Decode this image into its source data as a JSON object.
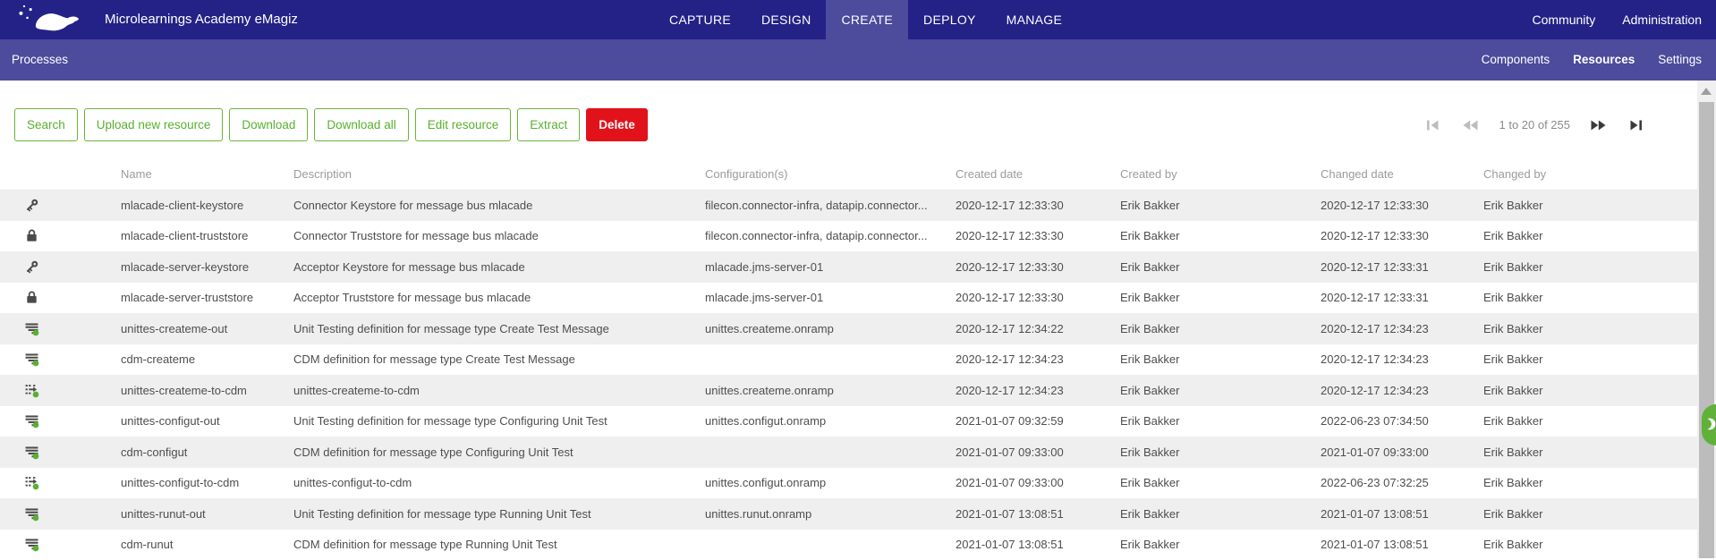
{
  "app": {
    "title": "Microlearnings Academy eMagiz",
    "logo": "emagiz-platypus-logo",
    "nav": [
      {
        "label": "CAPTURE",
        "active": false
      },
      {
        "label": "DESIGN",
        "active": false
      },
      {
        "label": "CREATE",
        "active": true
      },
      {
        "label": "DEPLOY",
        "active": false
      },
      {
        "label": "MANAGE",
        "active": false
      }
    ],
    "nav_right": [
      {
        "label": "Community"
      },
      {
        "label": "Administration"
      }
    ]
  },
  "subnav": {
    "left": "Processes",
    "right": [
      {
        "label": "Components",
        "active": false
      },
      {
        "label": "Resources",
        "active": true
      },
      {
        "label": "Settings",
        "active": false
      }
    ]
  },
  "toolbar": {
    "buttons": [
      {
        "label": "Search",
        "variant": "outline-green"
      },
      {
        "label": "Upload new resource",
        "variant": "outline-green"
      },
      {
        "label": "Download",
        "variant": "outline-green"
      },
      {
        "label": "Download all",
        "variant": "outline-green"
      },
      {
        "label": "Edit resource",
        "variant": "outline-green"
      },
      {
        "label": "Extract",
        "variant": "outline-green"
      },
      {
        "label": "Delete",
        "variant": "solid-red"
      }
    ]
  },
  "pagination": {
    "label": "1 to 20 of 255",
    "buttons": [
      {
        "name": "first-page",
        "enabled": false
      },
      {
        "name": "previous-page",
        "enabled": false
      },
      {
        "name": "next-page",
        "enabled": true
      },
      {
        "name": "last-page",
        "enabled": true
      }
    ]
  },
  "table": {
    "columns": [
      "Name",
      "Description",
      "Configuration(s)",
      "Created date",
      "Created by",
      "Changed date",
      "Changed by"
    ],
    "rows": [
      {
        "icon": "key-icon",
        "name": "mlacade-client-keystore",
        "description": "Connector Keystore for message bus mlacade",
        "configurations": "filecon.connector-infra, datapip.connector...",
        "created_date": "2020-12-17 12:33:30",
        "created_by": "Erik Bakker",
        "changed_date": "2020-12-17 12:33:30",
        "changed_by": "Erik Bakker"
      },
      {
        "icon": "lock-icon",
        "name": "mlacade-client-truststore",
        "description": "Connector Truststore for message bus mlacade",
        "configurations": "filecon.connector-infra, datapip.connector...",
        "created_date": "2020-12-17 12:33:30",
        "created_by": "Erik Bakker",
        "changed_date": "2020-12-17 12:33:30",
        "changed_by": "Erik Bakker"
      },
      {
        "icon": "key-icon",
        "name": "mlacade-server-keystore",
        "description": "Acceptor Keystore for message bus mlacade",
        "configurations": "mlacade.jms-server-01",
        "created_date": "2020-12-17 12:33:30",
        "created_by": "Erik Bakker",
        "changed_date": "2020-12-17 12:33:31",
        "changed_by": "Erik Bakker"
      },
      {
        "icon": "lock-icon",
        "name": "mlacade-server-truststore",
        "description": "Acceptor Truststore for message bus mlacade",
        "configurations": "mlacade.jms-server-01",
        "created_date": "2020-12-17 12:33:30",
        "created_by": "Erik Bakker",
        "changed_date": "2020-12-17 12:33:31",
        "changed_by": "Erik Bakker"
      },
      {
        "icon": "message-definition-icon",
        "name": "unittes-createme-out",
        "description": "Unit Testing definition for message type Create Test Message",
        "configurations": "unittes.createme.onramp",
        "created_date": "2020-12-17 12:34:22",
        "created_by": "Erik Bakker",
        "changed_date": "2020-12-17 12:34:23",
        "changed_by": "Erik Bakker"
      },
      {
        "icon": "message-definition-icon",
        "name": "cdm-createme",
        "description": "CDM definition for message type Create Test Message",
        "configurations": "",
        "created_date": "2020-12-17 12:34:23",
        "created_by": "Erik Bakker",
        "changed_date": "2020-12-17 12:34:23",
        "changed_by": "Erik Bakker"
      },
      {
        "icon": "transformation-icon",
        "name": "unittes-createme-to-cdm",
        "description": "unittes-createme-to-cdm",
        "configurations": "unittes.createme.onramp",
        "created_date": "2020-12-17 12:34:23",
        "created_by": "Erik Bakker",
        "changed_date": "2020-12-17 12:34:23",
        "changed_by": "Erik Bakker"
      },
      {
        "icon": "message-definition-icon",
        "name": "unittes-configut-out",
        "description": "Unit Testing definition for message type Configuring Unit Test",
        "configurations": "unittes.configut.onramp",
        "created_date": "2021-01-07 09:32:59",
        "created_by": "Erik Bakker",
        "changed_date": "2022-06-23 07:34:50",
        "changed_by": "Erik Bakker"
      },
      {
        "icon": "message-definition-icon",
        "name": "cdm-configut",
        "description": "CDM definition for message type Configuring Unit Test",
        "configurations": "",
        "created_date": "2021-01-07 09:33:00",
        "created_by": "Erik Bakker",
        "changed_date": "2021-01-07 09:33:00",
        "changed_by": "Erik Bakker"
      },
      {
        "icon": "transformation-icon",
        "name": "unittes-configut-to-cdm",
        "description": "unittes-configut-to-cdm",
        "configurations": "unittes.configut.onramp",
        "created_date": "2021-01-07 09:33:00",
        "created_by": "Erik Bakker",
        "changed_date": "2022-06-23 07:32:25",
        "changed_by": "Erik Bakker"
      },
      {
        "icon": "message-definition-icon",
        "name": "unittes-runut-out",
        "description": "Unit Testing definition for message type Running Unit Test",
        "configurations": "unittes.runut.onramp",
        "created_date": "2021-01-07 13:08:51",
        "created_by": "Erik Bakker",
        "changed_date": "2021-01-07 13:08:51",
        "changed_by": "Erik Bakker"
      },
      {
        "icon": "message-definition-icon",
        "name": "cdm-runut",
        "description": "CDM definition for message type Running Unit Test",
        "configurations": "",
        "created_date": "2021-01-07 13:08:51",
        "created_by": "Erik Bakker",
        "changed_date": "2021-01-07 13:08:51",
        "changed_by": "Erik Bakker"
      }
    ]
  },
  "colors": {
    "topbar": "#242286",
    "subnav": "#4c4b9c",
    "accent_green": "#6ab438",
    "danger_red": "#e2121b",
    "row_stripe": "#efefef",
    "icon_green_dot": "#56b230"
  }
}
